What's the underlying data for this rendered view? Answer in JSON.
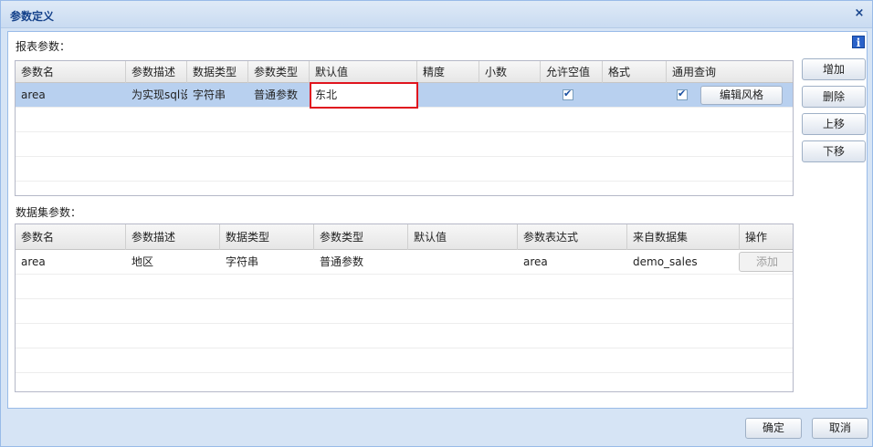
{
  "window": {
    "title": "参数定义"
  },
  "report_params": {
    "label": "报表参数：",
    "columns": [
      "参数名",
      "参数描述",
      "数据类型",
      "参数类型",
      "默认值",
      "精度",
      "小数",
      "允许空值",
      "格式",
      "通用查询"
    ],
    "rows": [
      {
        "name": "area",
        "description": "为实现sql设",
        "data_type": "字符串",
        "param_type": "普通参数",
        "default_value": "东北",
        "precision": "",
        "decimals": "",
        "allow_null": true,
        "format": "",
        "general_query": true,
        "edit_style_label": "编辑风格"
      }
    ]
  },
  "dataset_params": {
    "label": "数据集参数：",
    "columns": [
      "参数名",
      "参数描述",
      "数据类型",
      "参数类型",
      "默认值",
      "参数表达式",
      "来自数据集",
      "操作"
    ],
    "rows": [
      {
        "name": "area",
        "description": "地区",
        "data_type": "字符串",
        "param_type": "普通参数",
        "default_value": "",
        "expression": "area",
        "dataset": "demo_sales",
        "action_label": "添加"
      }
    ]
  },
  "side_buttons": {
    "add": "增加",
    "delete": "删除",
    "move_up": "上移",
    "move_down": "下移"
  },
  "footer": {
    "ok": "确定",
    "cancel": "取消"
  },
  "icons": {
    "info": "i",
    "close": "×"
  },
  "colors": {
    "selected_row": "#b8d0ef",
    "highlight": "#e0141e",
    "title": "#15428b"
  }
}
